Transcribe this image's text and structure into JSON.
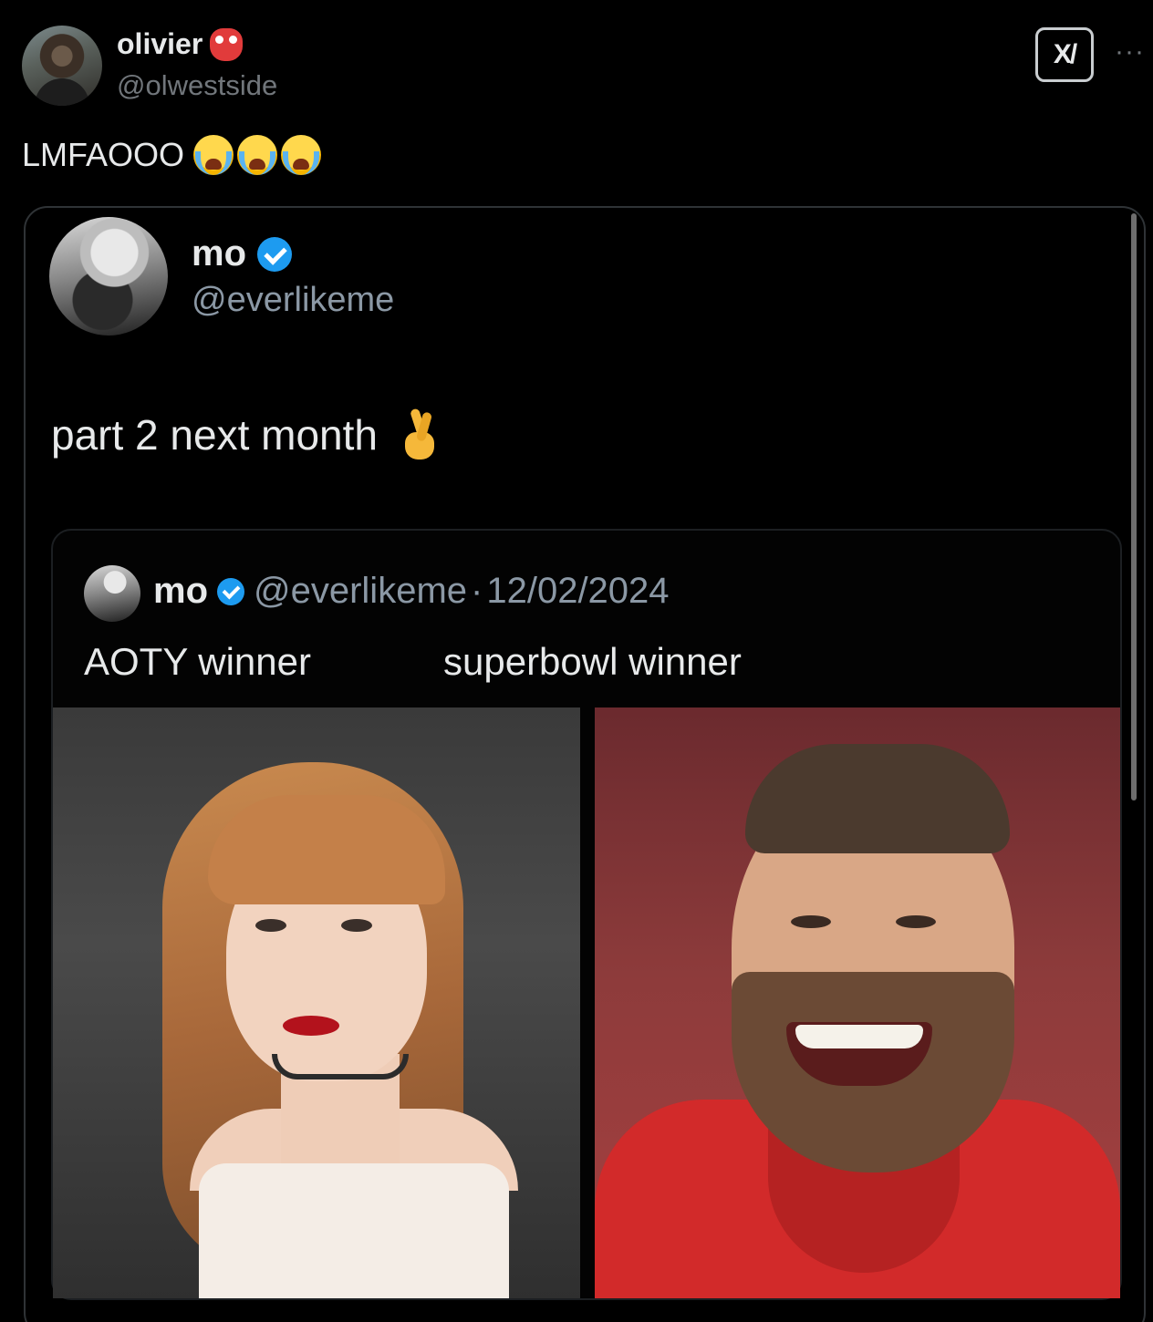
{
  "outer_tweet": {
    "author_name": "olivier",
    "author_handle": "@olwestside",
    "text": "LMFAOOO",
    "emoji_after_name": "goblin-emoji",
    "emoji_after_text": [
      "loudly-crying-face",
      "loudly-crying-face",
      "loudly-crying-face"
    ],
    "grok_button_label": "X/",
    "more_label": "···"
  },
  "quoted_tweet": {
    "author_name": "mo",
    "author_handle": "@everlikeme",
    "verified": true,
    "text": "part 2 next month",
    "emoji_after_text": "crossed-fingers",
    "nested_quote": {
      "author_name": "mo",
      "author_handle": "@everlikeme",
      "separator": "·",
      "date": "12/02/2024",
      "label_left": "AOTY winner",
      "label_right": "superbowl winner"
    }
  },
  "colors": {
    "background": "#000000",
    "text_primary": "#e7e9ea",
    "text_secondary": "#71767b",
    "verified_blue": "#1d9bf0",
    "border": "#2f3336"
  }
}
